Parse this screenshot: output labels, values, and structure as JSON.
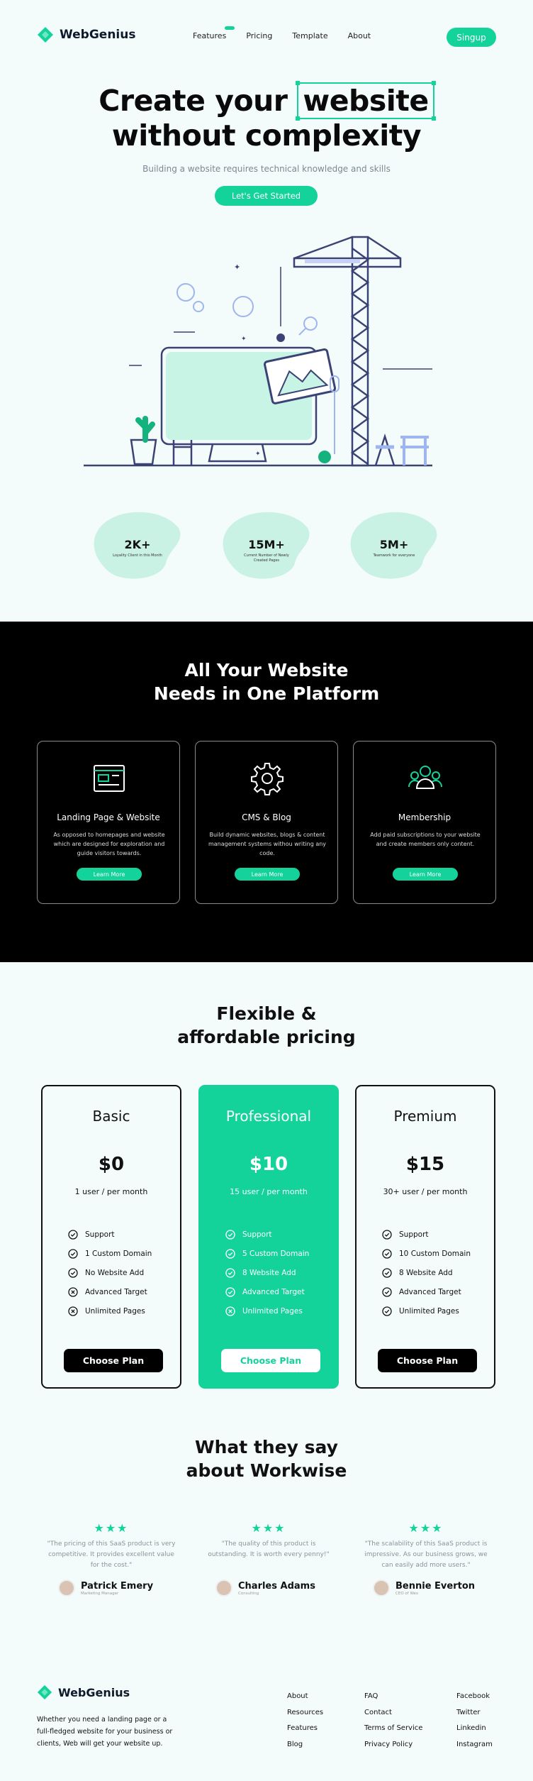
{
  "brand": {
    "name": "WebGenius",
    "accent": "#14d39a"
  },
  "nav": {
    "items": [
      "Features",
      "Pricing",
      "Template",
      "About"
    ],
    "signup": "Singup"
  },
  "hero": {
    "title_part1": "Create your",
    "title_highlight": "website",
    "title_line2": "without complexity",
    "subtitle": "Building a website requires technical knowledge and skills",
    "cta": "Let's Get Started"
  },
  "stats": [
    {
      "value": "2K+",
      "label": "Loyality Client in this Month"
    },
    {
      "value": "15M+",
      "label": "Current Number of Newly Created Pages"
    },
    {
      "value": "5M+",
      "label": "Teamwork for everyone"
    }
  ],
  "features": {
    "title_line1": "All Your Website",
    "title_line2": "Needs in One Platform",
    "cards": [
      {
        "icon": "layout-icon",
        "title": "Landing Page & Website",
        "desc": "As opposed to homepages and website which are designed for exploration and guide visitors towards.",
        "button": "Learn More"
      },
      {
        "icon": "gear-icon",
        "title": "CMS & Blog",
        "desc": "Build dynamic websites, blogs & content management systems withou writing any code.",
        "button": "Learn More"
      },
      {
        "icon": "users-icon",
        "title": "Membership",
        "desc": "Add paid subscriptions to your website and create members only content.",
        "button": "Learn More"
      }
    ]
  },
  "pricing": {
    "title_line1": "Flexible &",
    "title_line2": "affordable pricing",
    "plans": [
      {
        "name": "Basic",
        "price": "$0",
        "unit": "1 user / per month",
        "features": [
          {
            "t": "Support",
            "ok": true
          },
          {
            "t": "1 Custom Domain",
            "ok": true
          },
          {
            "t": "No Website Add",
            "ok": true
          },
          {
            "t": "Advanced Target",
            "ok": false
          },
          {
            "t": "Unlimited Pages",
            "ok": false
          }
        ],
        "button": "Choose Plan"
      },
      {
        "name": "Professional",
        "price": "$10",
        "unit": "15 user / per month",
        "features": [
          {
            "t": "Support",
            "ok": true
          },
          {
            "t": "5 Custom Domain",
            "ok": true
          },
          {
            "t": "8 Website Add",
            "ok": true
          },
          {
            "t": "Advanced Target",
            "ok": true
          },
          {
            "t": "Unlimited Pages",
            "ok": false
          }
        ],
        "button": "Choose Plan"
      },
      {
        "name": "Premium",
        "price": "$15",
        "unit": "30+ user / per month",
        "features": [
          {
            "t": "Support",
            "ok": true
          },
          {
            "t": "10 Custom Domain",
            "ok": true
          },
          {
            "t": "8 Website Add",
            "ok": true
          },
          {
            "t": "Advanced Target",
            "ok": true
          },
          {
            "t": "Unlimited Pages",
            "ok": true
          }
        ],
        "button": "Choose Plan"
      }
    ]
  },
  "testimonials": {
    "title_line1": "What they say",
    "title_line2": "about Workwise",
    "items": [
      {
        "quote": "\"The pricing of this SaaS product is very competitive. It provides excellent value for the cost.\"",
        "name": "Patrick Emery",
        "role": "Marketing Manager"
      },
      {
        "quote": "\"The quality of this product is outstanding. It is worth every penny!\"",
        "name": "Charles Adams",
        "role": "Consulting"
      },
      {
        "quote": "\"The scalability of this SaaS product is impressive. As our business grows, we can easily add more users.\"",
        "name": "Bennie Everton",
        "role": "CEO of Wex"
      }
    ]
  },
  "footer": {
    "desc": "Whether you need a landing page or a full-fledged website for your business or clients, Web will get your website up.",
    "col1": [
      "About",
      "Resources",
      "Features",
      "Blog"
    ],
    "col2": [
      "FAQ",
      "Contact",
      "Terms of Service",
      "Privacy Policy"
    ],
    "col3": [
      "Facebook",
      "Twitter",
      "Linkedin",
      "Instagram"
    ]
  }
}
